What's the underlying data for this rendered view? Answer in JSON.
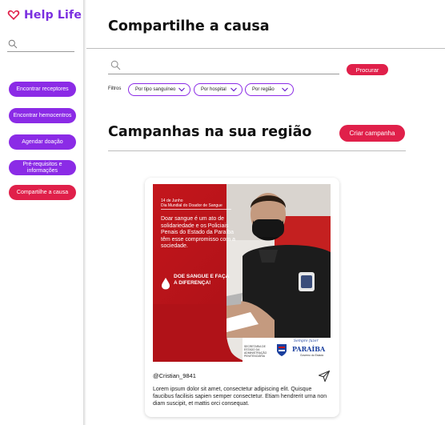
{
  "app": {
    "name": "Help Life"
  },
  "colors": {
    "brand": "#7a2ee0",
    "primary_purple": "#8b2be6",
    "accent_red": "#e0204a"
  },
  "sidebar": {
    "search_icon": "search-icon",
    "items": [
      {
        "label": "Encontrar receptores",
        "active": false
      },
      {
        "label": "Encontrar hemocentros",
        "active": false
      },
      {
        "label": "Agendar doação",
        "active": false
      },
      {
        "label": "Pré-requisitos e informações",
        "active": false
      },
      {
        "label": "Compartilhe a causa",
        "active": true
      }
    ]
  },
  "main": {
    "page_title": "Compartilhe a causa",
    "search": {
      "placeholder": "",
      "value": "",
      "button_label": "Procurar"
    },
    "filters": {
      "label": "Filtros",
      "options": [
        "Por tipo sanguíneo",
        "Por hospital",
        "Por região"
      ]
    },
    "section_title": "Campanhas na sua região",
    "create_campaign_label": "Criar campanha"
  },
  "post": {
    "image": {
      "date_line1": "14 de Junho",
      "date_line2": "Dia Mundial do Doador de Sangue",
      "body": "Doar sangue é um ato de solidariedade e os Policiais Penais do Estado da Paraíba têm esse compromisso com a sociedade.",
      "cta": "DOE SANGUE E FAÇA A DIFERENÇA!",
      "footer_secretaria": "SECRETARIA DE ESTADO DA ADMINISTRAÇÃO PENITENCIÁRIA",
      "footer_script": "Sempre fazer",
      "footer_state": "PARAÍBA",
      "footer_gov": "Governo do Estado"
    },
    "username": "@Cristian_9841",
    "caption": "Lorem ipsum dolor sit amet, consectetur adipiscing elit. Quisque faucibus facilisis sapien semper consectetur. Etiam hendrerit urna non diam suscipit, et mattis orci consequat."
  }
}
